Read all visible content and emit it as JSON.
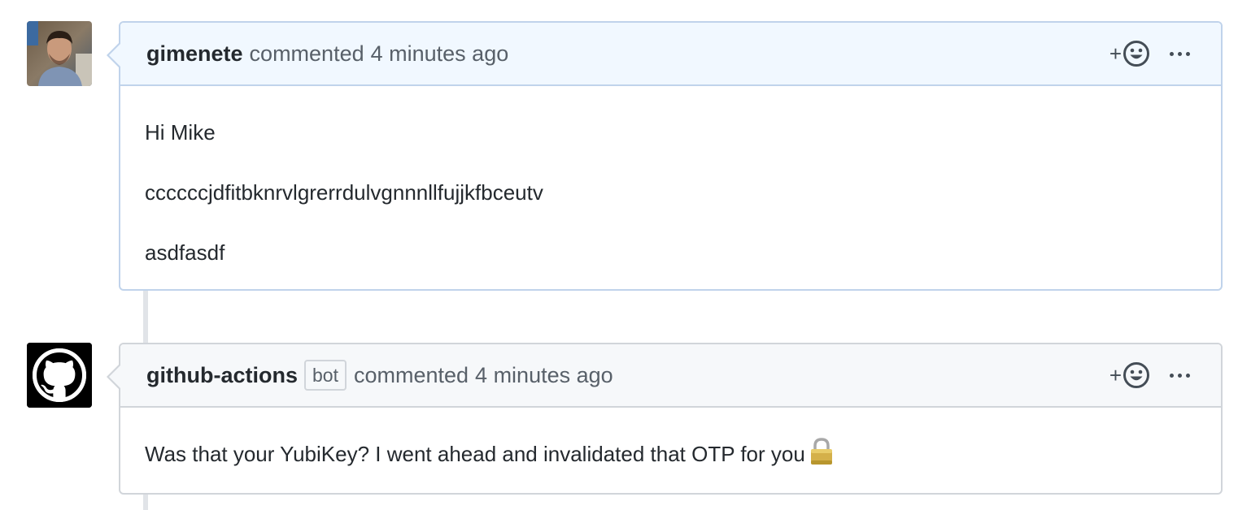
{
  "comments": [
    {
      "author": "gimenete",
      "action": "commented",
      "time": "4 minutes ago",
      "paragraphs": [
        "Hi Mike",
        "ccccccjdfitbknrvlgrerrdulvgnnnllfujjkfbceutv",
        "asdfasdf"
      ],
      "reaction_plus": "+",
      "header_bg": "#f1f8ff",
      "border_color": "#c0d3eb"
    },
    {
      "author": "github-actions",
      "badge": "bot",
      "action": "commented",
      "time": "4 minutes ago",
      "body": "Was that your YubiKey? I went ahead and invalidated that OTP for you",
      "emoji": "lock-icon",
      "reaction_plus": "+",
      "header_bg": "#f6f8fa",
      "border_color": "#d1d5da"
    }
  ]
}
